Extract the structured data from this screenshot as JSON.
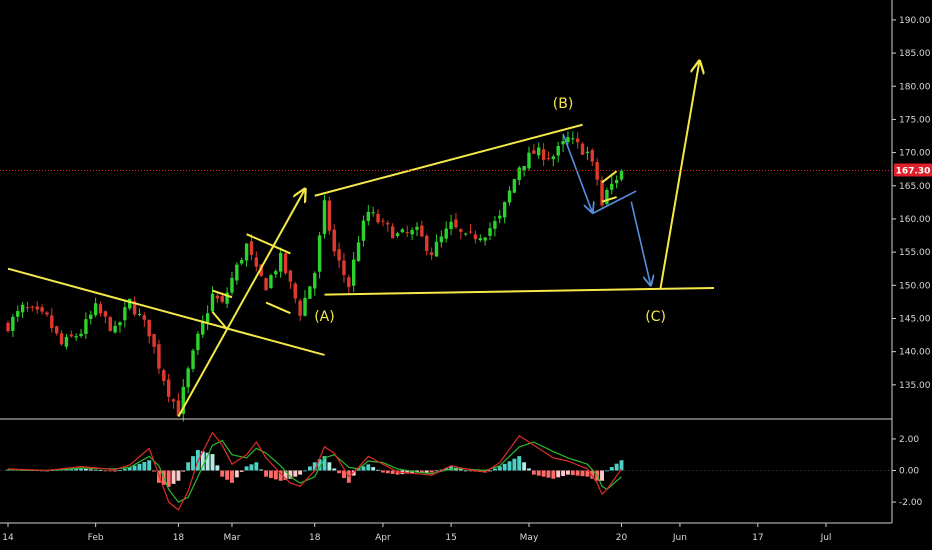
{
  "chart_data": [
    {
      "type": "candlestick",
      "panel": "price",
      "y_axis_side": "right",
      "ylim": [
        130,
        193
      ],
      "y_ticks": [
        "135.00",
        "140.00",
        "145.00",
        "150.00",
        "155.00",
        "160.00",
        "165.00",
        "170.00",
        "175.00",
        "180.00",
        "185.00",
        "190.00"
      ],
      "y_tick_values": [
        135,
        140,
        145,
        150,
        155,
        160,
        165,
        170,
        175,
        180,
        185,
        190
      ],
      "last_price": 167.3,
      "last_price_label": "167.30",
      "price_path": [
        [
          "Jan 14",
          144
        ],
        [
          "Jan 17",
          146.5
        ],
        [
          "Jan 22",
          145
        ],
        [
          "Jan 25",
          141
        ],
        [
          "Jan 29",
          143
        ],
        [
          "Feb 1",
          146.5
        ],
        [
          "Feb 5",
          143
        ],
        [
          "Feb 8",
          147.5
        ],
        [
          "Feb 12",
          143
        ],
        [
          "Feb 14",
          138
        ],
        [
          "Feb 16",
          134
        ],
        [
          "Feb 18",
          131
        ],
        [
          "Feb 20",
          137
        ],
        [
          "Feb 22",
          142
        ],
        [
          "Feb 25",
          148.5
        ],
        [
          "Feb 27",
          147
        ],
        [
          "Mar 1",
          151
        ],
        [
          "Mar 4",
          156
        ],
        [
          "Mar 6",
          152
        ],
        [
          "Mar 8",
          150
        ],
        [
          "Mar 11",
          154
        ],
        [
          "Mar 13",
          150
        ],
        [
          "Mar 15",
          146
        ],
        [
          "Mar 18",
          152
        ],
        [
          "Mar 20",
          162
        ],
        [
          "Mar 22",
          155
        ],
        [
          "Mar 25",
          150
        ],
        [
          "Mar 27",
          157
        ],
        [
          "Mar 29",
          161
        ],
        [
          "Apr 1",
          159
        ],
        [
          "Apr 4",
          157.5
        ],
        [
          "Apr 8",
          158
        ],
        [
          "Apr 11",
          155
        ],
        [
          "Apr 15",
          159
        ],
        [
          "Apr 18",
          157
        ],
        [
          "Apr 22",
          158
        ],
        [
          "Apr 25",
          160
        ],
        [
          "Apr 29",
          168
        ],
        [
          "May 2",
          170
        ],
        [
          "May 6",
          169.5
        ],
        [
          "May 9",
          172
        ],
        [
          "May 13",
          170
        ],
        [
          "May 15",
          166
        ],
        [
          "May 16",
          162
        ],
        [
          "May 17",
          164
        ],
        [
          "May 20",
          167.3
        ]
      ],
      "annotations": [
        {
          "label": "(A)",
          "date": "Mar 20",
          "price": 145.2
        },
        {
          "label": "(B)",
          "date": "May 8",
          "price": 177.3
        },
        {
          "label": "(C)",
          "date": "May 27",
          "price": 145.2
        }
      ],
      "colors": {
        "up": "#26a69a",
        "down": "#ef5350",
        "up_bright": "#2ed22e",
        "down_bright": "#e03a2e",
        "trendline": "#f5e94a",
        "projection": "#5a8de0",
        "price_line": "#e02020"
      }
    },
    {
      "type": "macd",
      "panel": "indicator",
      "ylim": [
        -3.2,
        3.2
      ],
      "y_ticks": [
        "2.00",
        "0.00",
        "-2.00"
      ],
      "y_tick_values": [
        2,
        0,
        -2
      ],
      "macd_line": [
        [
          "Jan 14",
          0.1
        ],
        [
          "Jan 22",
          0.0
        ],
        [
          "Jan 29",
          0.25
        ],
        [
          "Feb 5",
          0.05
        ],
        [
          "Feb 8",
          0.35
        ],
        [
          "Feb 12",
          1.4
        ],
        [
          "Feb 14",
          -0.3
        ],
        [
          "Feb 16",
          -2.0
        ],
        [
          "Feb 18",
          -2.5
        ],
        [
          "Feb 20",
          -1.3
        ],
        [
          "Feb 22",
          0.6
        ],
        [
          "Feb 25",
          2.4
        ],
        [
          "Feb 27",
          1.6
        ],
        [
          "Mar 1",
          0.4
        ],
        [
          "Mar 4",
          1.0
        ],
        [
          "Mar 6",
          1.8
        ],
        [
          "Mar 8",
          0.8
        ],
        [
          "Mar 11",
          -0.2
        ],
        [
          "Mar 13",
          -0.8
        ],
        [
          "Mar 15",
          -1.0
        ],
        [
          "Mar 18",
          0.0
        ],
        [
          "Mar 20",
          1.5
        ],
        [
          "Mar 22",
          1.1
        ],
        [
          "Mar 25",
          -0.4
        ],
        [
          "Mar 27",
          0.2
        ],
        [
          "Mar 29",
          0.9
        ],
        [
          "Apr 1",
          0.4
        ],
        [
          "Apr 4",
          -0.1
        ],
        [
          "Apr 8",
          -0.2
        ],
        [
          "Apr 11",
          -0.3
        ],
        [
          "Apr 15",
          0.3
        ],
        [
          "Apr 18",
          0.1
        ],
        [
          "Apr 22",
          -0.1
        ],
        [
          "Apr 25",
          0.5
        ],
        [
          "Apr 29",
          2.2
        ],
        [
          "May 2",
          1.6
        ],
        [
          "May 6",
          0.8
        ],
        [
          "May 9",
          0.6
        ],
        [
          "May 13",
          0.1
        ],
        [
          "May 15",
          -0.8
        ],
        [
          "May 16",
          -1.5
        ],
        [
          "May 17",
          -1.2
        ],
        [
          "May 20",
          0.1
        ]
      ],
      "signal_line": [
        [
          "Jan 14",
          0.05
        ],
        [
          "Jan 22",
          0.0
        ],
        [
          "Jan 29",
          0.15
        ],
        [
          "Feb 5",
          0.1
        ],
        [
          "Feb 8",
          0.2
        ],
        [
          "Feb 12",
          0.9
        ],
        [
          "Feb 14",
          0.3
        ],
        [
          "Feb 16",
          -1.2
        ],
        [
          "Feb 18",
          -2.0
        ],
        [
          "Feb 20",
          -1.7
        ],
        [
          "Feb 22",
          -0.4
        ],
        [
          "Feb 25",
          1.6
        ],
        [
          "Feb 27",
          1.9
        ],
        [
          "Mar 1",
          1.0
        ],
        [
          "Mar 4",
          0.8
        ],
        [
          "Mar 6",
          1.4
        ],
        [
          "Mar 8",
          1.1
        ],
        [
          "Mar 11",
          0.3
        ],
        [
          "Mar 13",
          -0.4
        ],
        [
          "Mar 15",
          -0.8
        ],
        [
          "Mar 18",
          -0.4
        ],
        [
          "Mar 20",
          0.8
        ],
        [
          "Mar 22",
          1.0
        ],
        [
          "Mar 25",
          0.2
        ],
        [
          "Mar 27",
          0.1
        ],
        [
          "Mar 29",
          0.6
        ],
        [
          "Apr 1",
          0.5
        ],
        [
          "Apr 4",
          0.1
        ],
        [
          "Apr 8",
          -0.1
        ],
        [
          "Apr 11",
          -0.2
        ],
        [
          "Apr 15",
          0.1
        ],
        [
          "Apr 18",
          0.1
        ],
        [
          "Apr 22",
          0.0
        ],
        [
          "Apr 25",
          0.3
        ],
        [
          "Apr 29",
          1.5
        ],
        [
          "May 2",
          1.8
        ],
        [
          "May 6",
          1.2
        ],
        [
          "May 9",
          0.8
        ],
        [
          "May 13",
          0.4
        ],
        [
          "May 15",
          -0.3
        ],
        [
          "May 16",
          -1.0
        ],
        [
          "May 17",
          -1.2
        ],
        [
          "May 20",
          -0.4
        ]
      ],
      "colors": {
        "macd_line": "#e02a2a",
        "signal_line": "#2eb82e",
        "hist_pos_strong": "#4fd1c5",
        "hist_pos_weak": "#b2ebe6",
        "hist_neg_strong": "#ff6b66",
        "hist_neg_weak": "#ffc9c7"
      }
    }
  ],
  "time_axis": {
    "ticks": [
      {
        "label": "14",
        "date": "Jan 14"
      },
      {
        "label": "Feb",
        "date": "Feb 1"
      },
      {
        "label": "18",
        "date": "Feb 18"
      },
      {
        "label": "Mar",
        "date": "Mar 1"
      },
      {
        "label": "18",
        "date": "Mar 18"
      },
      {
        "label": "Apr",
        "date": "Apr 1"
      },
      {
        "label": "15",
        "date": "Apr 15"
      },
      {
        "label": "May",
        "date": "May 1"
      },
      {
        "label": "20",
        "date": "May 20"
      },
      {
        "label": "Jun",
        "date": "Jun 1"
      },
      {
        "label": "17",
        "date": "Jun 17"
      },
      {
        "label": "Jul",
        "date": "Jul 1"
      }
    ]
  }
}
